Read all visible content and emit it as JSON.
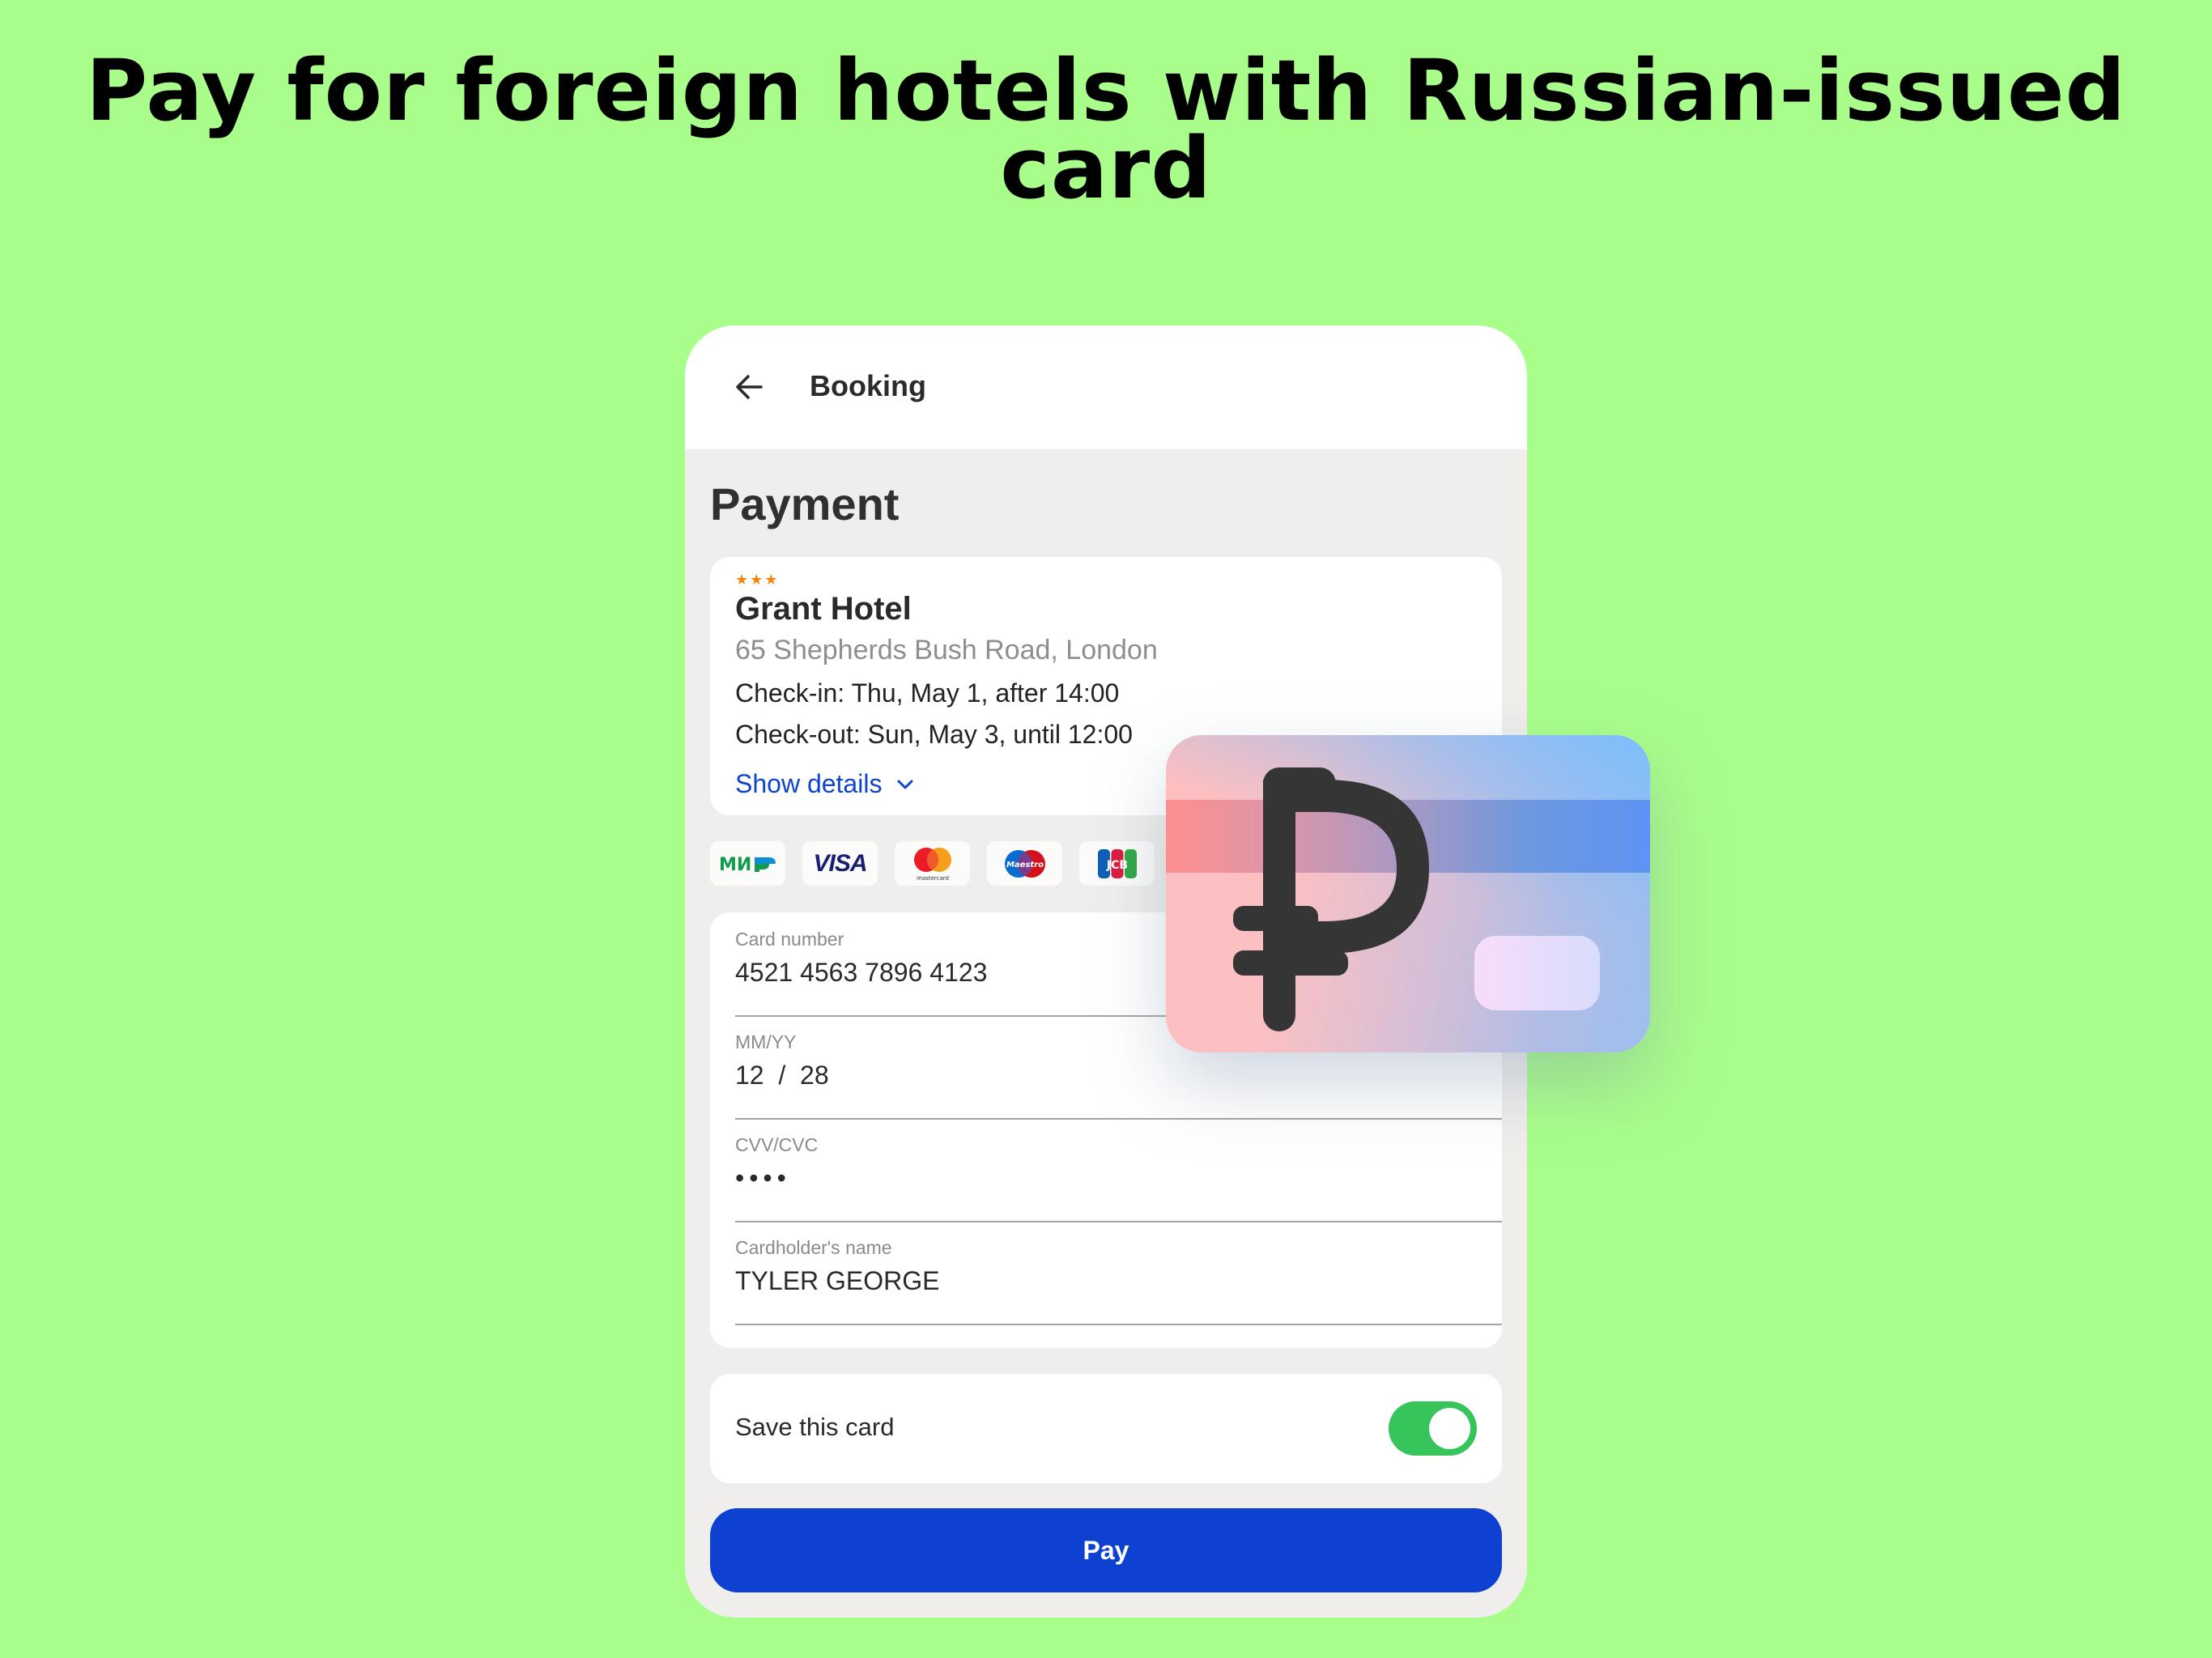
{
  "headline": {
    "line1": "Pay for foreign hotels with Russian-issued",
    "line2": "card"
  },
  "app": {
    "header": {
      "back_icon": "arrow-left-icon",
      "title": "Booking"
    },
    "page_title": "Payment",
    "hotel": {
      "stars": "★★★",
      "star_count": 3,
      "name": "Grant Hotel",
      "address": "65 Shepherds Bush Road, London",
      "check_in": "Check-in: Thu, May 1, after 14:00",
      "check_out": "Check-out: Sun, May 3, until 12:00",
      "show_details_label": "Show details"
    },
    "payment_systems": [
      {
        "name": "МИР",
        "icon": "mir-logo"
      },
      {
        "name": "VISA",
        "icon": "visa-logo"
      },
      {
        "name": "mastercard",
        "icon": "mastercard-logo"
      },
      {
        "name": "Maestro",
        "icon": "maestro-logo"
      },
      {
        "name": "JCB",
        "icon": "jcb-logo"
      }
    ],
    "form": {
      "card_number": {
        "label": "Card number",
        "value": "4521 4563 7896 4123"
      },
      "expiry": {
        "label": "MM/YY",
        "value": "12  /  28"
      },
      "cvv": {
        "label": "CVV/CVC",
        "value": "••••"
      },
      "cardholder": {
        "label": "Cardholder's name",
        "value": "TYLER GEORGE"
      }
    },
    "save_card": {
      "label": "Save this card",
      "enabled": true
    },
    "pay_button": "Pay"
  },
  "illustration": {
    "icon": "rouble-card-icon",
    "symbol": "₽"
  },
  "colors": {
    "background": "#a9fd8a",
    "accent_blue": "#0e40d2",
    "link_blue": "#0e43cf",
    "toggle_green": "#37c45b",
    "star_orange": "#f5860a"
  }
}
